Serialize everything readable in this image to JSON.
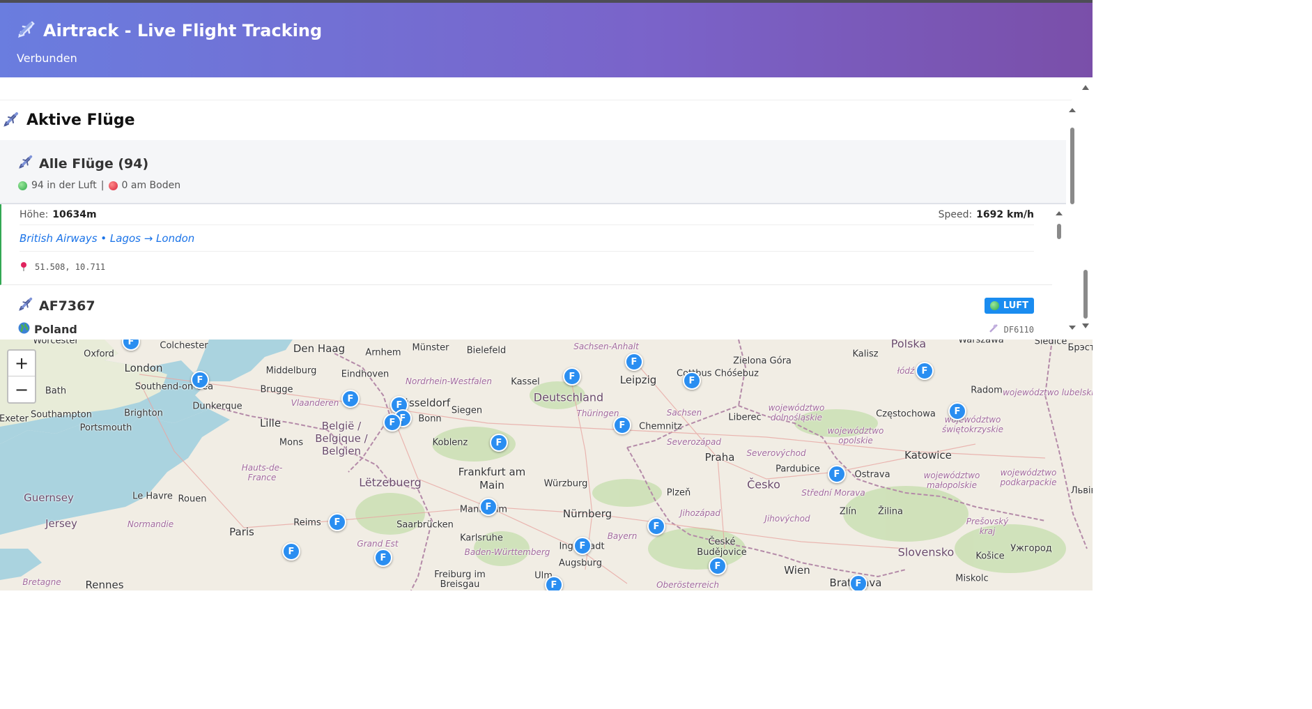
{
  "header": {
    "title": "Airtrack - Live Flight Tracking",
    "status": "Verbunden"
  },
  "section": {
    "title": "Aktive Flüge"
  },
  "summary": {
    "title": "Alle Flüge (94)",
    "in_air": "94 in der Luft",
    "separator": "|",
    "on_ground": "0 am Boden"
  },
  "flight_1": {
    "altitude_label": "Höhe:",
    "altitude_value": "10634m",
    "speed_label": "Speed:",
    "speed_value": "1692 km/h",
    "route": "British Airways • Lagos → London",
    "coords": "51.508, 10.711"
  },
  "flight_2": {
    "callsign": "AF7367",
    "status_badge": "LUFT",
    "country": "Poland",
    "icao": "DF6110"
  },
  "map": {
    "zoom_in": "+",
    "zoom_out": "−",
    "marker_label": "F",
    "markers_count": 25,
    "labels": {
      "worcester": "Worcester",
      "colchester": "Colchester",
      "den_haag": "Den Haag",
      "arnhem": "Arnhem",
      "munster": "Münster",
      "bielefeld": "Bielefeld",
      "sachsen_anhalt": "Sachsen-Anhalt",
      "polska": "Polska",
      "warszawa": "Warszawa",
      "siedlce": "Siedlce",
      "oxford": "Oxford",
      "london": "London",
      "southend": "Southend-on-Sea",
      "middelburg": "Middelburg",
      "eindhoven": "Eindhoven",
      "nordrhein": "Nordrhein-Westfalen",
      "kassel": "Kassel",
      "leipzig": "Leipzig",
      "cottbus": "Cottbus Chóśebuz",
      "zielona": "Zielona Góra",
      "kalisz": "Kalisz",
      "lodz": "łódź",
      "radom": "Radom",
      "bath": "Bath",
      "brugge": "Brugge",
      "vlaanderen": "Vlaanderen",
      "dusseldorf": "Düsseldorf",
      "deutschland": "Deutschland",
      "dunkerque": "Dunkerque",
      "southampton": "Southampton",
      "brighton": "Brighton",
      "portsmouth": "Portsmouth",
      "lille": "Lille",
      "belgie": "België / Belgique / Belgien",
      "bonn": "Bonn",
      "siegen": "Siegen",
      "thuringen": "Thüringen",
      "chemnitz": "Chemnitz",
      "sachsen": "Sachsen",
      "liberec": "Liberec",
      "dolnoslaskie": "województwo dolnośląskie",
      "opolskie": "województwo opolskie",
      "czestochowa": "Częstochowa",
      "swietokrzyskie": "województwo świętokrzyskie",
      "lubelskie": "województwo lubelskie",
      "mons": "Mons",
      "koblenz": "Koblenz",
      "severozapad": "Severozápad",
      "praha": "Praha",
      "severovychod": "Severovýchod",
      "katowice": "Katowice",
      "hauts": "Hauts-de-France",
      "letzebuerg": "Lëtzebuerg",
      "frankfurt": "Frankfurt am Main",
      "wurzburg": "Würzburg",
      "pardubice": "Pardubice",
      "ostrava": "Ostrava",
      "malopolskie": "województwo małopolskie",
      "podkarpackie": "województwo podkarpackie",
      "guernsey": "Guernsey",
      "le_havre": "Le Havre",
      "rouen": "Rouen",
      "plzen": "Plzeň",
      "cesko": "Česko",
      "stredni": "Střední Morava",
      "jersey": "Jersey",
      "normandie": "Normandie",
      "mannheim": "Mannheim",
      "nurnberg": "Nürnberg",
      "jihozapad": "Jihozápad",
      "jihovychod": "Jihovýchod",
      "zlin": "Zlín",
      "zilina": "Žilina",
      "presov": "Prešovský kraj",
      "reims": "Reims",
      "saarbrucken": "Saarbrücken",
      "paris": "Paris",
      "karlsruhe": "Karlsruhe",
      "bayern": "Bayern",
      "ceske": "České Budějovice",
      "grand_est": "Grand Est",
      "ingolstadt": "Ingolstadt",
      "bw": "Baden-Württemberg",
      "augsburg": "Augsburg",
      "slovensko": "Slovensko",
      "uzhorod": "Ужгород",
      "kosice": "Košice",
      "bretagne": "Bretagne",
      "rennes": "Rennes",
      "freiburg": "Freiburg im Breisgau",
      "ulm": "Ulm",
      "oberosterreich": "Oberösterreich",
      "wien": "Wien",
      "bratislava": "Bratislava",
      "miskolc": "Miskolc",
      "exeter": "Exeter",
      "lviv": "Львів",
      "brest": "Брэст"
    }
  },
  "colors": {
    "header_gradient_start": "#6a7ddf",
    "header_gradient_end": "#7a4fa9",
    "marker": "#2a8ef1",
    "badge": "#1a8cf0",
    "route_link": "#1a73e8",
    "air_card_border": "#33a853"
  },
  "icons": {
    "app": "airplane-icon",
    "in_air": "green-dot-icon",
    "on_ground": "red-dot-icon",
    "coords": "pin-icon",
    "country": "globe-icon",
    "icao": "satellite-icon"
  }
}
